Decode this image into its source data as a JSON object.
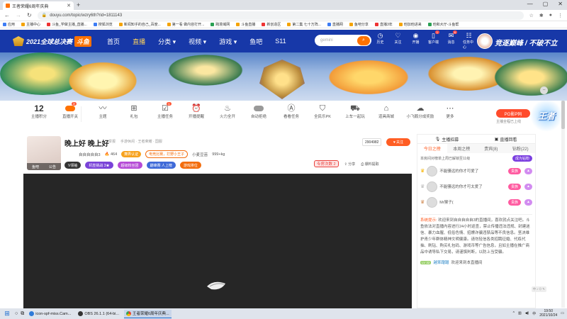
{
  "browser": {
    "tab_title": "王者荣耀6周年庆典",
    "url": "douyu.com/topic/wzry6th?rid=1811143",
    "bookmarks": [
      "应用",
      "主播中心",
      "斗鱼_学做主播_直播...",
      "搜狐浏览",
      "新闻知乎的自己_百度...",
      "第一看 做内容打开...",
      "跨境域网",
      "斗鱼直播",
      "新创造区",
      "第二集 七十万阵...",
      "直播网",
      "鱼吧分享",
      "直播3年",
      "他加他进来",
      "他和大厅-斗鱼帮"
    ]
  },
  "site": {
    "brand": "斗鱼",
    "logo_text": "2021全球总决赛",
    "nav": [
      "首页",
      "直播",
      "分类",
      "视频",
      "游戏",
      "鱼吧",
      "S11"
    ],
    "nav_active": "直播",
    "search_placeholder": "gemini",
    "header_icons": [
      {
        "label": "历史",
        "icon": "clock-icon",
        "badge": ""
      },
      {
        "label": "关注",
        "icon": "heart-icon",
        "badge": ""
      },
      {
        "label": "开播",
        "icon": "camera-icon",
        "badge": ""
      },
      {
        "label": "客户端",
        "icon": "phone-icon",
        "badge": "1"
      },
      {
        "label": "消息",
        "icon": "mail-icon",
        "badge": "6"
      },
      {
        "label": "任务中心",
        "icon": "task-icon",
        "badge": ""
      }
    ],
    "slogan": "竞逐巅峰 / 不破不立"
  },
  "toolbar": {
    "points_count": "12",
    "items": [
      {
        "label": "主播积分"
      },
      {
        "label": "直播开关",
        "badge": "3"
      },
      {
        "label": "主题"
      },
      {
        "label": "礼包"
      },
      {
        "label": "主播任务",
        "badge": "1"
      },
      {
        "label": "开播提醒"
      },
      {
        "label": "火力全开"
      },
      {
        "label": "自动拒绝"
      },
      {
        "label": "看看任务"
      },
      {
        "label": "全民乐PK"
      },
      {
        "label": "上车一起玩"
      },
      {
        "label": "道具商城"
      },
      {
        "label": "小飞鹅分成奖励"
      },
      {
        "label": "更多"
      }
    ],
    "pobi_button": "PO影P码",
    "pobi_sub": "主播全程已上线"
  },
  "room": {
    "title": "晚上好 晚上好",
    "report": "举报",
    "category": "手游休闲 · 王者荣耀 · 国服",
    "streamer": "自自自自自3",
    "level": "464",
    "anchor_cert": "舞弄认证",
    "hot_tag": "电竞比赛，打野小王子",
    "owner_tag": "小麦豆苗",
    "viewers_label": "999+kg",
    "thumb_caption_left": "鱼吧",
    "thumb_caption_right": "公告",
    "vip_chip": "V领袖",
    "chip_labels": [
      "机签挑战 3★",
      "超级粉丝团",
      "巅峰赛 人上榜",
      "游戏排位"
    ],
    "count": "2904982",
    "follow": "关注",
    "gift_tag": "专房次数 2",
    "share": "分享",
    "report_btn": "爆料提取"
  },
  "right_panel": {
    "top_tabs": [
      "主播招募",
      "直播回看"
    ],
    "tabs": [
      "今日之榜",
      "本周之榜",
      "贵宾(8)",
      "钻粉(22)"
    ],
    "active_tab": "今日之榜",
    "week_text": "本房间对榜单上周已解锁至11级",
    "week_button": "成为钻粉",
    "ranks": [
      {
        "name": "不能骚远的你才可爱了",
        "badge": "贵族"
      },
      {
        "name": "不能骚远的你才可太爱了",
        "badge": "贵族"
      },
      {
        "name": "Mr猴子(",
        "badge": "贵族"
      }
    ],
    "system_label": "系统提示:",
    "system_msg": "欢迎来到自自自自自3的直播间，喜欢就点关注吧。斗鱼依法对直播内容进行24小时巡查，禁止传播违法违规、封建迷信、暴力血腥、低俗色情、招嫖诈骗违禁品等不良信息。坚决维护青少年群体精神文明健康。请勿轻信各类招聘征婚、代练代抽、刷钻、购买礼包码、游戏币等广告信息，且如主播在推广商品中诱导私下交易，请谨慎判断，以防上当受骗。",
    "chat": {
      "level": "LV 32",
      "user": "越笨蹭蹭",
      "text": "欢迎来到本直播间"
    },
    "corner_tip": "中 ♪ ⊙ ✎"
  },
  "taskbar": {
    "tasks": [
      "icon-spf-miss.Cam...",
      "OBS 26.1.1 (64-bi...",
      "王者荣耀6周年庆典..."
    ],
    "tray_lang": "中",
    "time": "19:50",
    "date": "2021/10/24"
  }
}
